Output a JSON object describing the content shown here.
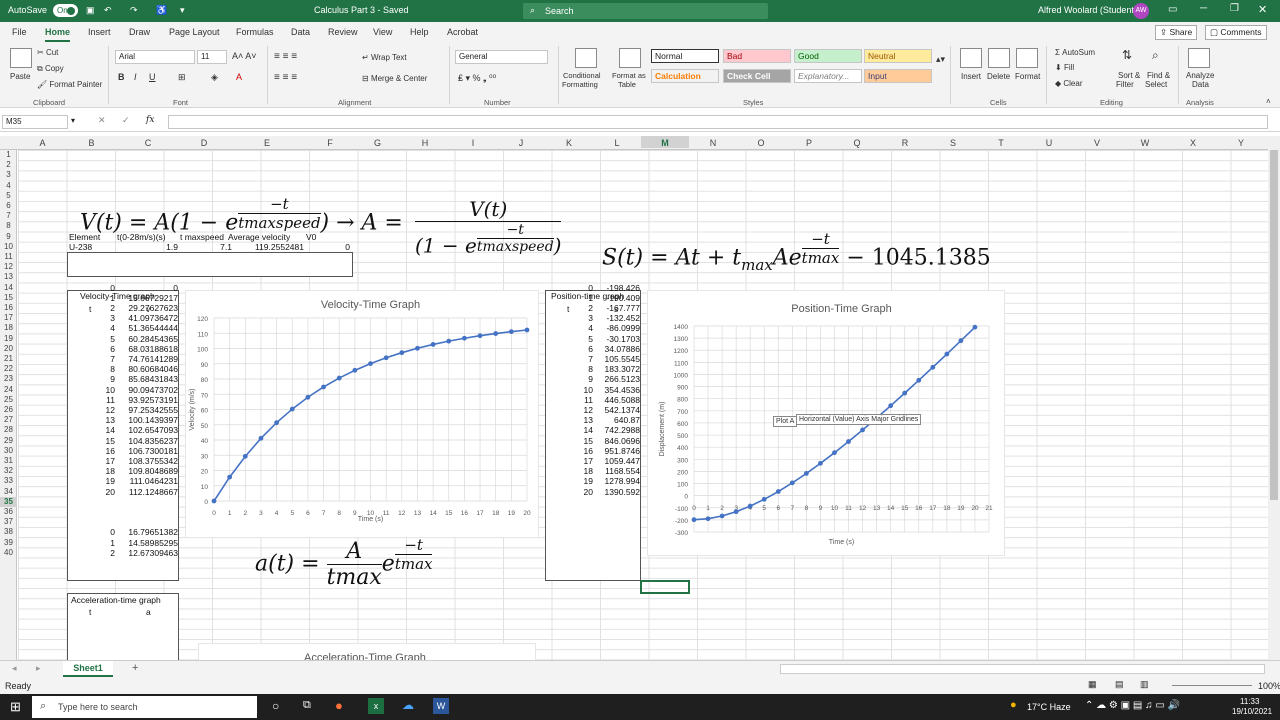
{
  "titlebar": {
    "autosave": "AutoSave",
    "autosave_state": "On",
    "doc_title": "Calculus Part 3 - Saved",
    "search": "Search",
    "user": "Alfred Woolard (Student)",
    "initials": "AW"
  },
  "menu": {
    "tabs": [
      "File",
      "Home",
      "Insert",
      "Draw",
      "Page Layout",
      "Formulas",
      "Data",
      "Review",
      "View",
      "Help",
      "Acrobat"
    ],
    "share": "Share",
    "comments": "Comments"
  },
  "ribbon": {
    "cut": "Cut",
    "copy": "Copy",
    "paste": "Paste",
    "format_painter": "Format Painter",
    "clipboard": "Clipboard",
    "font_name": "Arial",
    "font_size": "11",
    "font": "Font",
    "wrap_text": "Wrap Text",
    "merge_center": "Merge & Center",
    "alignment": "Alignment",
    "number_format": "General",
    "number": "Number",
    "conditional": "Conditional",
    "formatting": "Formatting",
    "format_as": "Format as",
    "table": "Table",
    "styles": {
      "normal": "Normal",
      "bad": "Bad",
      "good": "Good",
      "neutral": "Neutral",
      "calculation": "Calculation",
      "check_cell": "Check Cell",
      "explanatory": "Explanatory...",
      "input": "Input",
      "label": "Styles"
    },
    "insert": "Insert",
    "delete": "Delete",
    "format": "Format",
    "cells": "Cells",
    "autosum": "AutoSum",
    "fill": "Fill",
    "clear": "Clear",
    "sort_filter": "Sort &",
    "filter": "Filter",
    "find_select": "Find &",
    "select": "Select",
    "editing": "Editing",
    "analyze": "Analyze",
    "data_lbl": "Data",
    "analysis": "Analysis"
  },
  "formula_bar": {
    "name_box": "M35",
    "fx": "fx"
  },
  "columns": [
    "A",
    "B",
    "C",
    "D",
    "E",
    "F",
    "G",
    "H",
    "I",
    "J",
    "K",
    "L",
    "M",
    "N",
    "O",
    "P",
    "Q",
    "R",
    "S",
    "T",
    "U",
    "V",
    "W",
    "X",
    "Y"
  ],
  "rows": [
    "1",
    "2",
    "3",
    "4",
    "5",
    "6",
    "7",
    "8",
    "9",
    "10",
    "11",
    "12",
    "13",
    "14",
    "15",
    "16",
    "17",
    "18",
    "19",
    "20",
    "21",
    "22",
    "23",
    "24",
    "25",
    "26",
    "27",
    "28",
    "29",
    "30",
    "31",
    "32",
    "33",
    "34",
    "35",
    "36",
    "37",
    "38",
    "39",
    "40"
  ],
  "element_table": {
    "headers": [
      "Element",
      "t(0-28m/s)(s)",
      "t maxspeed",
      "Average velocity",
      "V0"
    ],
    "row": [
      "U-238",
      "1.9",
      "7.1",
      "119.2552481",
      "0"
    ]
  },
  "velocity_table": {
    "title": "Velocity-Time graph",
    "cols": [
      "t",
      "v"
    ],
    "t": [
      "0",
      "1",
      "2",
      "3",
      "4",
      "5",
      "6",
      "7",
      "8",
      "9",
      "10",
      "11",
      "12",
      "13",
      "14",
      "15",
      "16",
      "17",
      "18",
      "19",
      "20"
    ],
    "v": [
      "0",
      "15.66729217",
      "29.27627623",
      "41.09736472",
      "51.36544444",
      "60.28454365",
      "68.03188618",
      "74.76141289",
      "80.60684046",
      "85.68431843",
      "90.09473702",
      "93.92573191",
      "97.25342555",
      "100.1439397",
      "102.6547093",
      "104.8356237",
      "106.7300181",
      "108.3755342",
      "109.8048689",
      "111.0464231",
      "112.1248667"
    ]
  },
  "position_table": {
    "title": "Position-time graph",
    "cols": [
      "t",
      "s"
    ],
    "s": [
      "-198.426",
      "-190.409",
      "-167.777",
      "-132.452",
      "-86.0999",
      "-30.1703",
      "34.07886",
      "105.5545",
      "183.3072",
      "266.5123",
      "354.4536",
      "446.5088",
      "542.1374",
      "640.87",
      "742.2988",
      "846.0696",
      "951.8746",
      "1059.447",
      "1168.554",
      "1278.994",
      "1390.592"
    ]
  },
  "accel_table": {
    "title": "Acceleration-time graph",
    "cols": [
      "t",
      "a"
    ],
    "t": [
      "0",
      "1",
      "2"
    ],
    "a": [
      "16.79651382",
      "14.58985295",
      "12.67309463"
    ]
  },
  "equations": {
    "v_lhs": "V(t) = A(1 − e",
    "v_exp_num": "−t",
    "v_exp_den": "tmaxspeed",
    "v_close": ") → A =",
    "a_num": "V(t)",
    "a_den_pre": "(1 − e",
    "a_den_close": ")",
    "s_pre": "S(t) = At + t",
    "s_sub": "max",
    "s_mid": "Ae",
    "s_exp_num": "−t",
    "s_exp_den": "tmax",
    "s_post": "− 1045.1385",
    "acc_lhs": "a(t) =",
    "acc_num": "A",
    "acc_den": "tmax",
    "acc_e": "e",
    "acc_exp_num": "−t",
    "acc_exp_den": "tmax"
  },
  "chart_data": [
    {
      "type": "line",
      "title": "Velocity-Time Graph",
      "xlabel": "Time (s)",
      "ylabel": "Velocity (m/s)",
      "x": [
        0,
        1,
        2,
        3,
        4,
        5,
        6,
        7,
        8,
        9,
        10,
        11,
        12,
        13,
        14,
        15,
        16,
        17,
        18,
        19,
        20
      ],
      "series": [
        {
          "values": [
            0,
            15.667,
            29.276,
            41.097,
            51.365,
            60.285,
            68.032,
            74.761,
            80.607,
            85.684,
            90.095,
            93.926,
            97.253,
            100.144,
            102.655,
            104.836,
            106.73,
            108.376,
            109.805,
            111.046,
            112.125
          ]
        }
      ],
      "ylim": [
        0,
        120
      ],
      "yticks": [
        "0",
        "10",
        "20",
        "30",
        "40",
        "50",
        "60",
        "70",
        "80",
        "90",
        "100",
        "110",
        "120"
      ],
      "xticks": [
        "0",
        "1",
        "2",
        "3",
        "4",
        "5",
        "6",
        "7",
        "8",
        "9",
        "10",
        "11",
        "12",
        "13",
        "14",
        "15",
        "16",
        "17",
        "18",
        "19",
        "20"
      ],
      "grid": true,
      "color": "#4472c4"
    },
    {
      "type": "line",
      "title": "Position-Time Graph",
      "xlabel": "Time (s)",
      "ylabel": "Displacement (m)",
      "x": [
        0,
        1,
        2,
        3,
        4,
        5,
        6,
        7,
        8,
        9,
        10,
        11,
        12,
        13,
        14,
        15,
        16,
        17,
        18,
        19,
        20
      ],
      "series": [
        {
          "values": [
            -198.426,
            -190.409,
            -167.777,
            -132.452,
            -86.0999,
            -30.1703,
            34.07886,
            105.5545,
            183.3072,
            266.5123,
            354.4536,
            446.5088,
            542.1374,
            640.87,
            742.2988,
            846.0696,
            951.8746,
            1059.447,
            1168.554,
            1278.994,
            1390.592
          ]
        }
      ],
      "ylim": [
        -300,
        1400
      ],
      "yticks": [
        "-300",
        "-200",
        "-100",
        "0",
        "100",
        "200",
        "300",
        "400",
        "500",
        "600",
        "700",
        "800",
        "900",
        "1000",
        "1100",
        "1200",
        "1300",
        "1400"
      ],
      "xticks": [
        "0",
        "1",
        "2",
        "3",
        "4",
        "5",
        "6",
        "7",
        "8",
        "9",
        "10",
        "11",
        "12",
        "13",
        "14",
        "15",
        "16",
        "17",
        "18",
        "19",
        "20",
        "21"
      ],
      "grid": true,
      "color": "#4472c4",
      "tooltip_a": "Plot A",
      "tooltip_b": "Horizontal (Value) Axis Major Gridlines"
    },
    {
      "type": "line",
      "title": "Acceleration-Time Graph"
    }
  ],
  "sheets": {
    "active": "Sheet1",
    "add": "+"
  },
  "status": {
    "ready": "Ready",
    "zoom": "100%"
  },
  "taskbar": {
    "search": "Type here to search",
    "weather": "17°C Haze",
    "time": "11:33",
    "date": "19/10/2021"
  }
}
